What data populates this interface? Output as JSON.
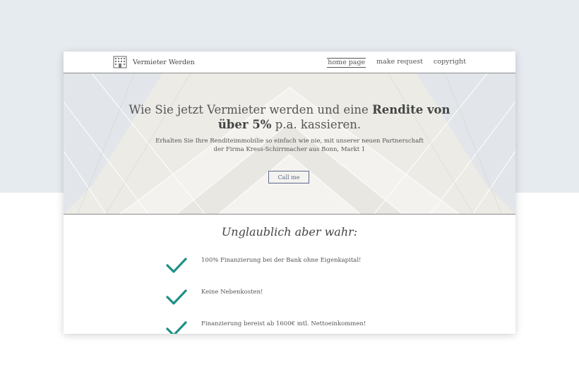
{
  "nav": {
    "brand": "Vermieter Werden",
    "links": [
      "home page",
      "make request",
      "copyright"
    ]
  },
  "hero": {
    "title_plain_1": "Wie Sie jetzt Vermieter werden und eine ",
    "title_bold": "Rendite von über 5%",
    "title_plain_2": " p.a. kassieren.",
    "subtitle_line1": "Erhalten Sie Ihre Renditeimmobilie so einfach wie nie, mit unserer neuen Partnerschaft",
    "subtitle_line2": "der Firma Kress-Schirrmacher aus Bonn, Markt 1",
    "button": "Call me"
  },
  "features": {
    "title": "Unglaublich aber wahr:",
    "items": [
      "100% Finanzierung bei der Bank ohne Eigenkapital!",
      "Keine Nebenkosten!",
      "Finanzierung bereist ab 1600€ mtl. Nettoeinkommen!"
    ]
  },
  "colors": {
    "page_bg_top": "#e6ebf0",
    "check": "#1f8f87",
    "button_border": "#5a6a8a"
  },
  "icons": {
    "brand": "building-icon",
    "feature": "checkmark-icon"
  }
}
